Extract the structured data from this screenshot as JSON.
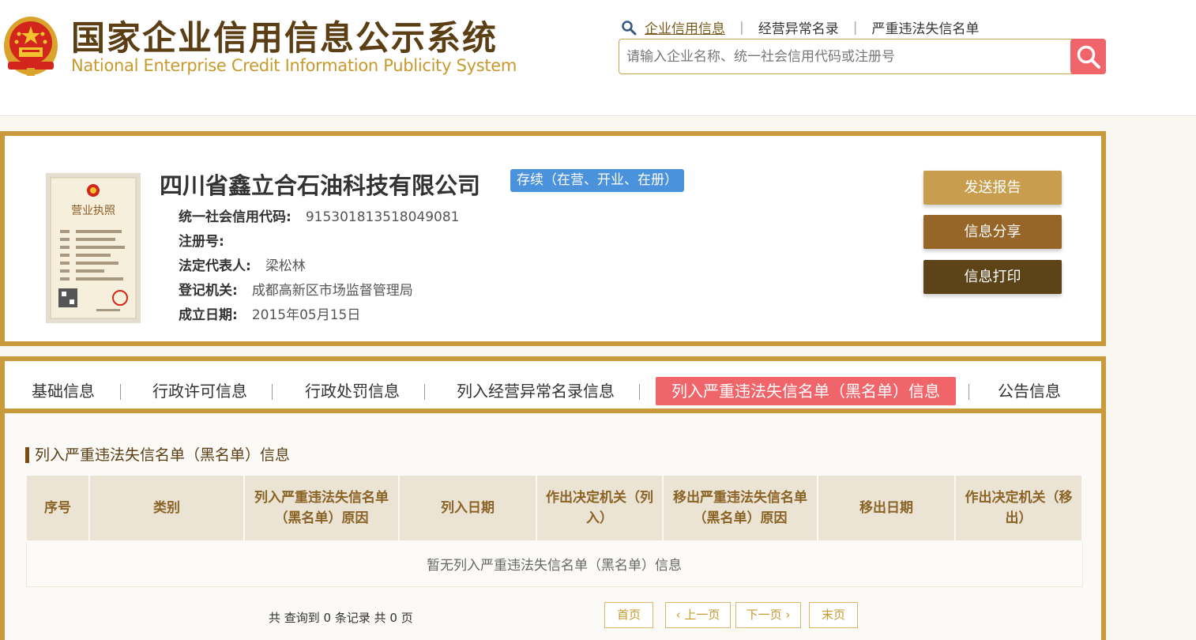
{
  "header": {
    "title": "国家企业信用信息公示系统",
    "subtitle": "National Enterprise Credit Information Publicity System",
    "logo_icon": "national-emblem-icon",
    "nav": [
      {
        "label": "企业信用信息",
        "active": true
      },
      {
        "label": "经营异常名录",
        "active": false
      },
      {
        "label": "严重违法失信名单",
        "active": false
      }
    ],
    "nav_separator": "|",
    "search": {
      "placeholder": "请输入企业名称、统一社会信用代码或注册号",
      "value": "",
      "button_icon": "search-icon"
    }
  },
  "company": {
    "name": "四川省鑫立合石油科技有限公司",
    "status": "存续（在营、开业、在册）",
    "license_icon": "business-license-icon",
    "license_text": "营业执照",
    "fields": [
      {
        "label": "统一社会信用代码:",
        "value": "915301813518049081"
      },
      {
        "label": "注册号:",
        "value": ""
      },
      {
        "label": "法定代表人:",
        "value": "梁松林"
      },
      {
        "label": "登记机关:",
        "value": "成都高新区市场监督管理局"
      },
      {
        "label": "成立日期:",
        "value": "2015年05月15日"
      }
    ],
    "actions": [
      {
        "label": "发送报告",
        "color": "#c89e4e"
      },
      {
        "label": "信息分享",
        "color": "#986528"
      },
      {
        "label": "信息打印",
        "color": "#5c4318"
      }
    ]
  },
  "tabs": [
    {
      "label": "基础信息",
      "active": false
    },
    {
      "label": "行政许可信息",
      "active": false
    },
    {
      "label": "行政处罚信息",
      "active": false
    },
    {
      "label": "列入经营异常名录信息",
      "active": false
    },
    {
      "label": "列入严重违法失信名单（黑名单）信息",
      "active": true
    },
    {
      "label": "公告信息",
      "active": false
    }
  ],
  "section": {
    "title": "列入严重违法失信名单（黑名单）信息",
    "table": {
      "columns": [
        "序号",
        "类别",
        "列入严重违法失信名单（黑名单）原因",
        "列入日期",
        "作出决定机关（列入）",
        "移出严重违法失信名单（黑名单）原因",
        "移出日期",
        "作出决定机关（移出）"
      ],
      "empty_text": "暂无列入严重违法失信名单（黑名单）信息"
    },
    "summary": "共 查询到 0 条记录 共 0 页",
    "pager": [
      "首页",
      "上一页",
      "下一页",
      "末页"
    ]
  },
  "colors": {
    "brand_gold": "#c89a3c",
    "title_brown": "#5b3e14",
    "accent_red": "#f0656a",
    "status_blue": "#4b92dc"
  }
}
